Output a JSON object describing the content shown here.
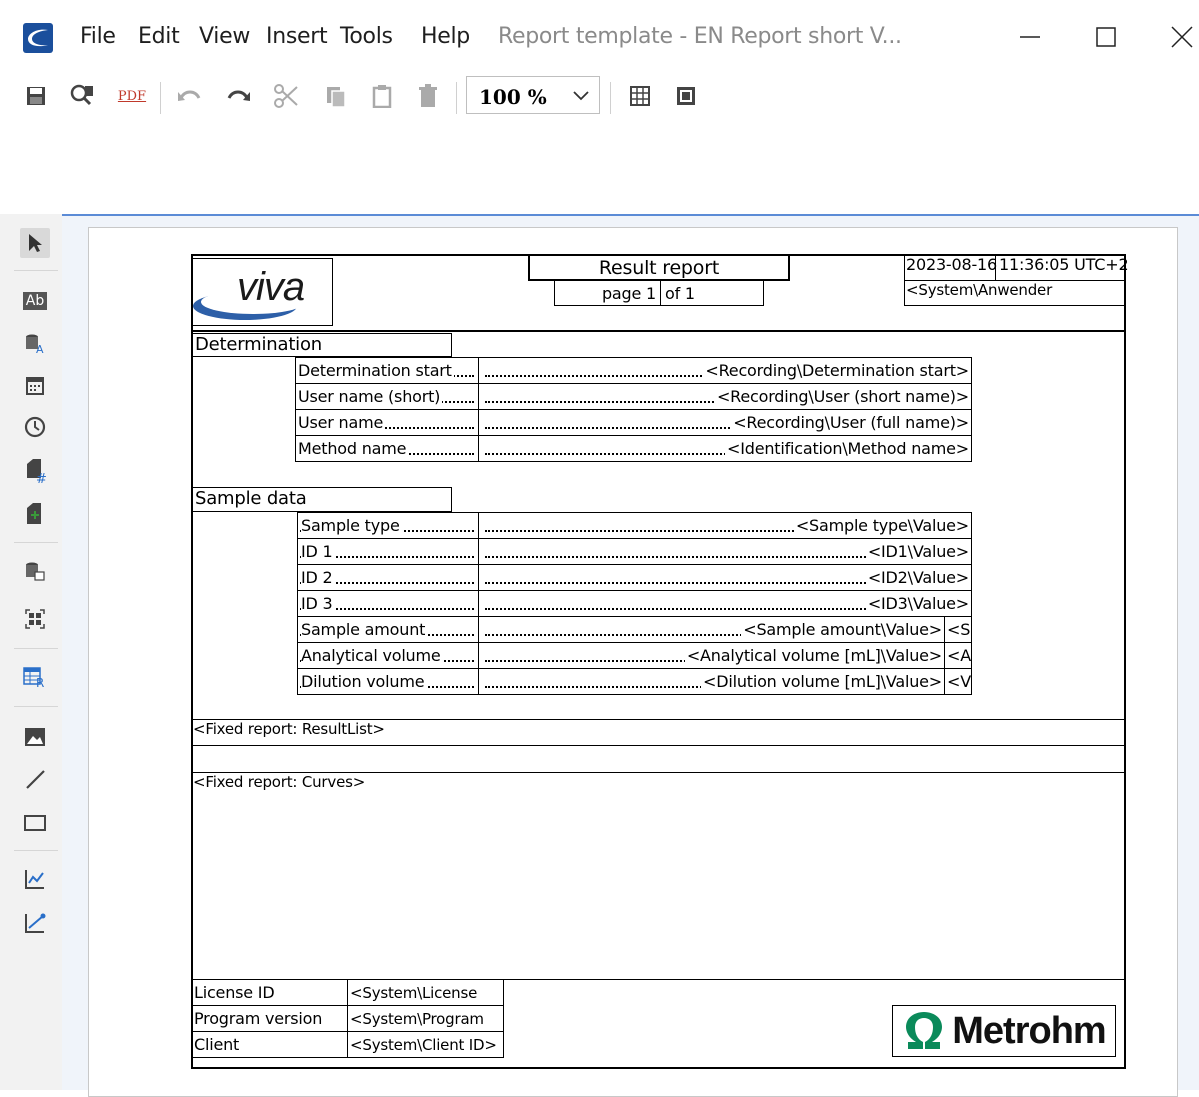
{
  "window": {
    "menu": [
      "File",
      "Edit",
      "View",
      "Insert",
      "Tools",
      "Help"
    ],
    "title": "Report template - EN Report short V..."
  },
  "toolbar": {
    "icons": [
      "save-icon",
      "preview-icon",
      "pdf-icon",
      "undo-icon",
      "redo-icon",
      "cut-icon",
      "copy-icon",
      "paste-icon",
      "delete-icon",
      "grid-icon",
      "fit-page-icon"
    ],
    "pdf_label": "PDF",
    "zoom": "100 %"
  },
  "palette": {
    "icons": [
      "pointer-icon",
      "text-field-icon",
      "database-text-icon",
      "calendar-icon",
      "clock-icon",
      "page-number-icon",
      "page-add-icon",
      "database-table-icon",
      "barcode-icon",
      "report-table-icon",
      "image-icon",
      "line-icon",
      "rectangle-icon",
      "curve-icon",
      "scatter-curve-icon"
    ],
    "text_label": "Ab"
  },
  "report": {
    "header": {
      "logo": "viva",
      "title": "Result report",
      "page_label": "page 1",
      "of_label": "of 1",
      "date": "2023-08-16",
      "time": "11:36:05 UTC+2",
      "user": "<System\\Anwender"
    },
    "determination": {
      "heading": "Determination",
      "rows": [
        {
          "label": "Determination start",
          "value": "<Recording\\Determination start>"
        },
        {
          "label": "User name (short)",
          "value": "<Recording\\User (short name)>"
        },
        {
          "label": "User name",
          "value": "<Recording\\User (full name)>"
        },
        {
          "label": "Method name",
          "value": "<Identification\\Method name>"
        }
      ]
    },
    "sample": {
      "heading": "Sample data",
      "rows": [
        {
          "label": "Sample type",
          "value": "<Sample type\\Value>",
          "unit": ""
        },
        {
          "label": "ID 1",
          "value": "<ID1\\Value>",
          "unit": ""
        },
        {
          "label": "ID 2",
          "value": "<ID2\\Value>",
          "unit": ""
        },
        {
          "label": "ID 3",
          "value": "<ID3\\Value>",
          "unit": ""
        },
        {
          "label": "Sample amount",
          "value": "<Sample amount\\Value>",
          "unit": "<S"
        },
        {
          "label": "Analytical volume",
          "value": "<Analytical volume [mL]\\Value>",
          "unit": "<A"
        },
        {
          "label": "Dilution volume",
          "value": "<Dilution volume [mL]\\Value>",
          "unit": "<V"
        }
      ]
    },
    "fixed_result_list": "<Fixed report: ResultList>",
    "fixed_curves": "<Fixed report: Curves>",
    "footer": {
      "rows": [
        {
          "label": "License ID",
          "value": "<System\\License"
        },
        {
          "label": "Program version",
          "value": "<System\\Program"
        },
        {
          "label": "Client",
          "value": "<System\\Client ID>"
        }
      ],
      "logo": "Metrohm",
      "logo_color": "#0a8a5a"
    }
  }
}
